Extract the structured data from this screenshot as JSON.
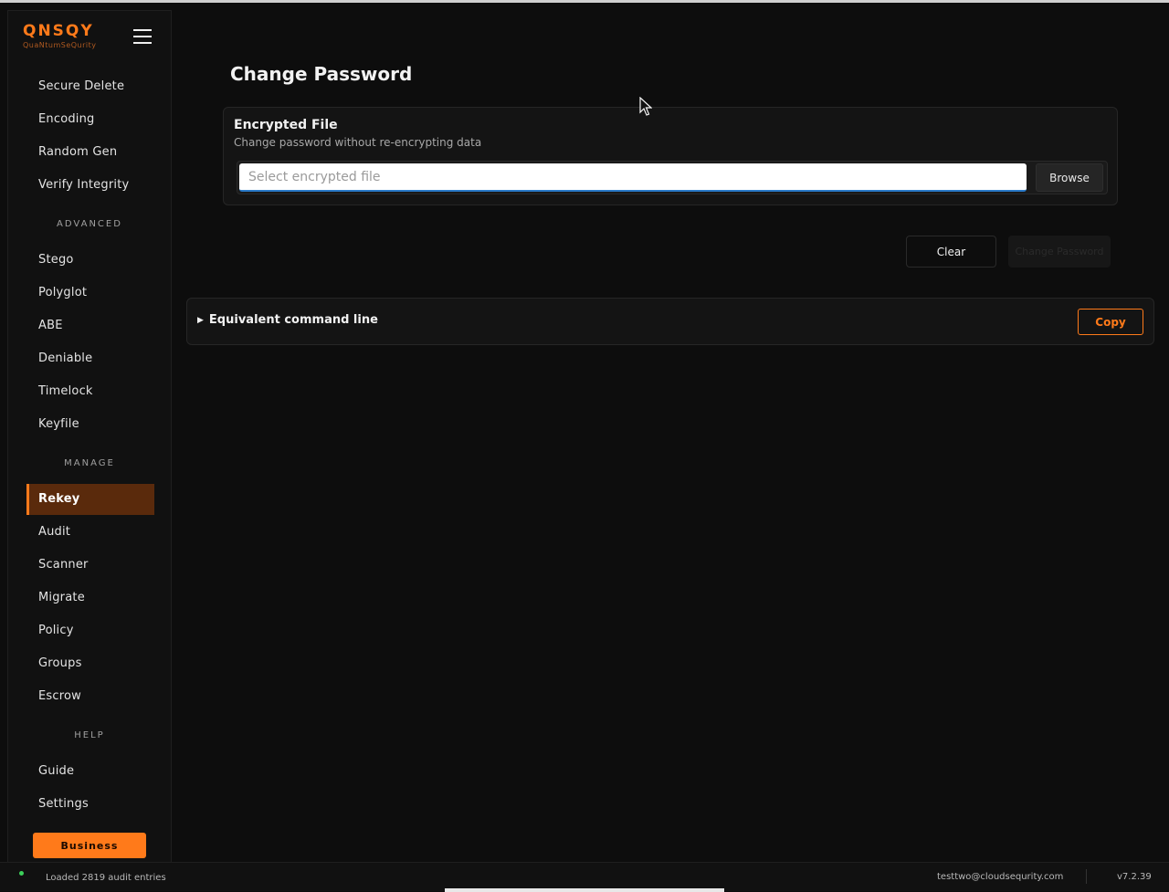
{
  "brand": {
    "logo": "QNSQY",
    "tagline": "QuaNtumSeQurity"
  },
  "sidebar": {
    "items_top": [
      "Secure Delete",
      "Encoding",
      "Random Gen",
      "Verify Integrity"
    ],
    "sections": {
      "advanced": "ADVANCED",
      "manage": "MANAGE",
      "help": "HELP"
    },
    "advanced_items": [
      "Stego",
      "Polyglot",
      "ABE",
      "Deniable",
      "Timelock",
      "Keyfile"
    ],
    "manage_items": [
      "Rekey",
      "Audit",
      "Scanner",
      "Migrate",
      "Policy",
      "Groups",
      "Escrow"
    ],
    "help_items": [
      "Guide",
      "Settings"
    ],
    "active_item": "Rekey",
    "business_label": "Business"
  },
  "main": {
    "title": "Change Password",
    "card": {
      "title": "Encrypted File",
      "subtitle": "Change password without re-encrypting data",
      "file_placeholder": "Select encrypted file",
      "file_value": "",
      "browse_label": "Browse"
    },
    "clear_label": "Clear",
    "change_label": "Change Password",
    "command_panel": {
      "toggle_label": "Equivalent command line",
      "copy_label": "Copy"
    }
  },
  "status": {
    "message": "Loaded 2819 audit entries",
    "user": "testtwo@cloudsequrity.com",
    "version": "v7.2.39"
  },
  "colors": {
    "accent": "#ff7a1a",
    "active_bg": "#5a2a0c",
    "status_ok": "#3ccf5a"
  }
}
